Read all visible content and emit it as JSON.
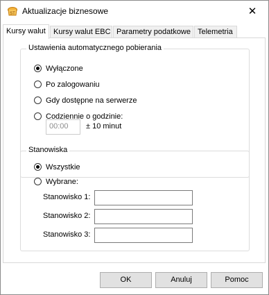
{
  "window": {
    "title": "Aktualizacje biznesowe",
    "close_glyph": "✕"
  },
  "tabs": [
    {
      "label": "Kursy walut",
      "active": true
    },
    {
      "label": "Kursy walut EBC",
      "active": false
    },
    {
      "label": "Parametry podatkowe",
      "active": false
    },
    {
      "label": "Telemetria",
      "active": false
    }
  ],
  "auto_download": {
    "legend": "Ustawienia automatycznego pobierania",
    "options": [
      {
        "label": "Wyłączone",
        "checked": true
      },
      {
        "label": "Po zalogowaniu",
        "checked": false
      },
      {
        "label": "Gdy dostępne na serwerze",
        "checked": false
      },
      {
        "label": "Codziennie o godzinie:",
        "checked": false
      }
    ],
    "time_value": "00:00",
    "tolerance_label": "± 10 minut"
  },
  "workstations": {
    "legend": "Stanowiska",
    "options": [
      {
        "label": "Wszystkie",
        "checked": true
      },
      {
        "label": "Wybrane:",
        "checked": false
      }
    ],
    "fields": [
      {
        "label": "Stanowisko 1:",
        "value": ""
      },
      {
        "label": "Stanowisko 2:",
        "value": ""
      },
      {
        "label": "Stanowisko 3:",
        "value": ""
      }
    ]
  },
  "buttons": {
    "ok": "OK",
    "cancel": "Anuluj",
    "help": "Pomoc"
  },
  "icons": {
    "app": "app-logo-icon",
    "close": "close-icon"
  },
  "colors": {
    "accent_logo": "#f0a020"
  }
}
